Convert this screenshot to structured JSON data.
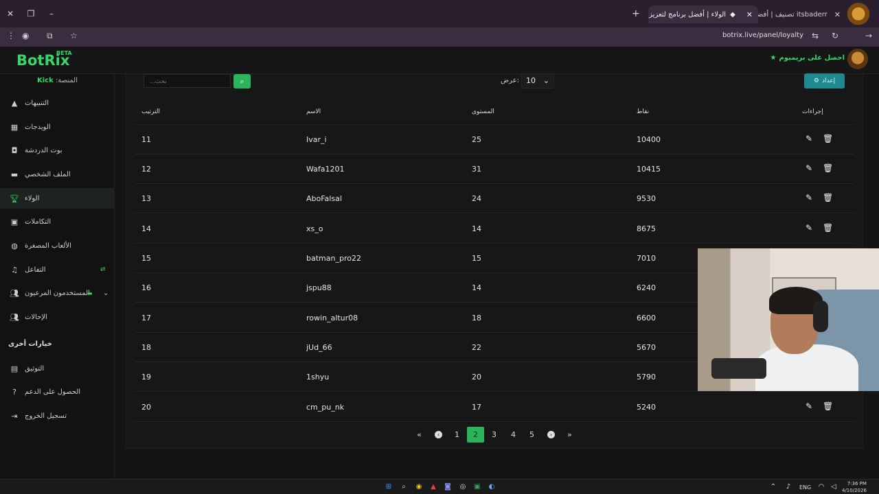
{
  "browser": {
    "tabs": [
      {
        "title": "الولاء | أفضل برنامج لتعزيز البث",
        "active": true
      },
      {
        "title": "itsbaderr تصنيف | أفضل برنامج",
        "active": false
      }
    ],
    "url": "botrix.live/panel/loyalty"
  },
  "header": {
    "logo": "BotRix",
    "beta": "BETA",
    "premium_label": "احصل على بريميوم"
  },
  "sidebar": {
    "platform_label": "المنصة:",
    "platform_value": "Kick",
    "items": [
      {
        "label": "التنبيهات",
        "icon": "alert-icon",
        "active": false
      },
      {
        "label": "الويدجات",
        "icon": "widgets-icon",
        "active": false
      },
      {
        "label": "بوت الدردشة",
        "icon": "bot-icon",
        "active": false
      },
      {
        "label": "الملف الشخصي",
        "icon": "profile-icon",
        "active": false
      },
      {
        "label": "الولاء",
        "icon": "trophy-icon",
        "active": true
      },
      {
        "label": "التكاملات",
        "icon": "integrations-icon",
        "active": false
      },
      {
        "label": "الألعاب المصغرة",
        "icon": "gamepad-icon",
        "active": false
      },
      {
        "label": "التفاعل",
        "icon": "music-icon",
        "active": false
      },
      {
        "label": "المستخدمون المرعيون",
        "icon": "users-icon",
        "active": false
      },
      {
        "label": "الإحالات",
        "icon": "referrals-icon",
        "active": false
      }
    ],
    "other_title": "خيارات أخرى",
    "other_items": [
      {
        "label": "التوثيق",
        "icon": "docs-icon"
      },
      {
        "label": "الحصول على الدعم",
        "icon": "help-icon"
      },
      {
        "label": "تسجيل الخروج",
        "icon": "logout-icon"
      }
    ]
  },
  "toolbar": {
    "search_placeholder": "بحث...",
    "show_label": "عرض:",
    "show_value": "10",
    "settings_label": "إعداد"
  },
  "table": {
    "columns": [
      "الترتيب",
      "الاسم",
      "المستوى",
      "نقاط",
      "إجراءات"
    ],
    "rows": [
      {
        "rank": "11",
        "name": "Ivar_i",
        "level": "25",
        "points": "10400"
      },
      {
        "rank": "12",
        "name": "Wafa1201",
        "level": "31",
        "points": "10415"
      },
      {
        "rank": "13",
        "name": "AboFalsal",
        "level": "24",
        "points": "9530"
      },
      {
        "rank": "14",
        "name": "xs_o",
        "level": "14",
        "points": "8675"
      },
      {
        "rank": "15",
        "name": "batman_pro22",
        "level": "15",
        "points": "7010"
      },
      {
        "rank": "16",
        "name": "jspu88",
        "level": "14",
        "points": "6240"
      },
      {
        "rank": "17",
        "name": "rowin_altur08",
        "level": "18",
        "points": "6600"
      },
      {
        "rank": "18",
        "name": "jUd_66",
        "level": "22",
        "points": "5670"
      },
      {
        "rank": "19",
        "name": "1shyu",
        "level": "20",
        "points": "5790"
      },
      {
        "rank": "20",
        "name": "cm_pu_nk",
        "level": "17",
        "points": "5240"
      }
    ]
  },
  "pagination": {
    "pages": [
      "1",
      "2",
      "3",
      "4",
      "5"
    ],
    "current": "2",
    "first": "«",
    "prev": "‹",
    "next": "›",
    "last": "»"
  },
  "taskbar": {
    "lang": "ENG",
    "time": "7:36 PM",
    "date": "4/10/2026"
  },
  "colors": {
    "accent": "#38d66b",
    "accent_button": "#2ab55c",
    "settings_button": "#1e8a8f"
  }
}
